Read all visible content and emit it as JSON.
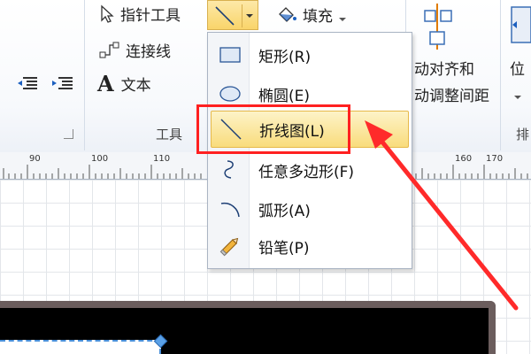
{
  "ribbon": {
    "pointer_tool": "指针工具",
    "connector": "连接线",
    "text_tool": "文本",
    "text_tool_glyph": "A",
    "fill": "填充",
    "group_tools_label": "工具",
    "auto_align_line1": "动对齐和",
    "auto_align_line2": "动调整间距",
    "position_label": "位",
    "arrange_label": "排"
  },
  "ruler": {
    "ticks": [
      "90",
      "100",
      "110",
      "160",
      "170"
    ]
  },
  "menu": {
    "items": [
      {
        "label": "矩形(R)",
        "icon": "rectangle-icon"
      },
      {
        "label": "椭圆(E)",
        "icon": "ellipse-icon"
      },
      {
        "label": "折线图(L)",
        "icon": "line-icon"
      },
      {
        "label": "任意多边形(F)",
        "icon": "freeform-icon"
      },
      {
        "label": "弧形(A)",
        "icon": "arc-icon"
      },
      {
        "label": "铅笔(P)",
        "icon": "pencil-icon"
      }
    ]
  },
  "colors": {
    "highlight": "#f9dc7c",
    "annotation": "#ff2020"
  }
}
